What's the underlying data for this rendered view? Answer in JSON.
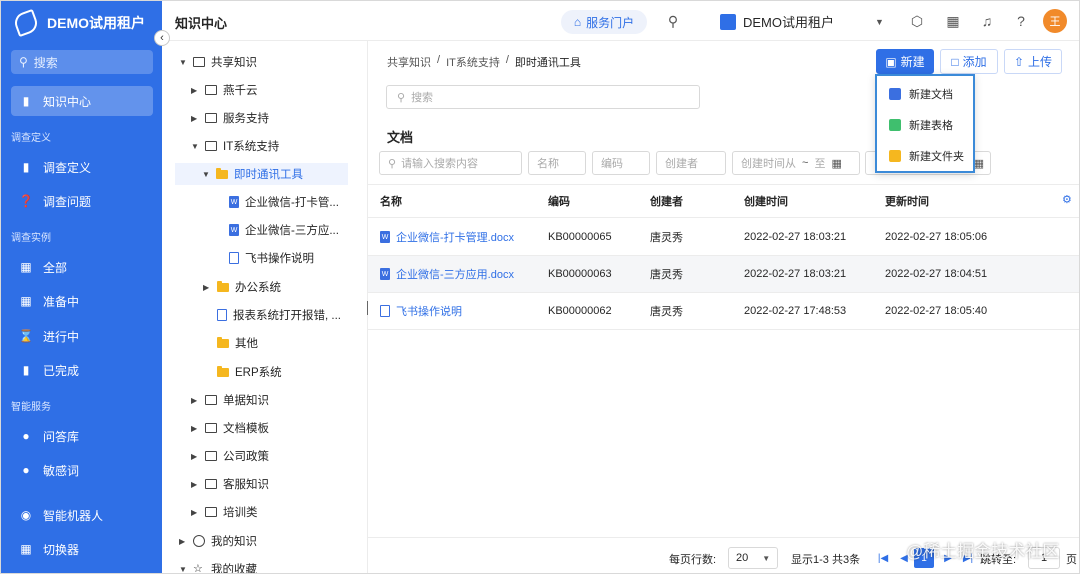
{
  "sidebar": {
    "tenant_name": "DEMO试用租户",
    "search_placeholder": "搜索",
    "items": {
      "knowledge": "知识中心",
      "survey_def": "调查定义",
      "survey_question": "调查问题",
      "all": "全部",
      "preparing": "准备中",
      "in_progress": "进行中",
      "done": "已完成",
      "qa_lib": "问答库",
      "sensitive": "敏感词",
      "bot": "智能机器人",
      "switcher": "切换器"
    },
    "groups": {
      "survey_def": "调查定义",
      "survey_instance": "调查实例",
      "smart_service": "智能服务"
    }
  },
  "topbar": {
    "title": "知识中心",
    "portal": "服务门户",
    "tenant": "DEMO试用租户",
    "avatar": "王"
  },
  "tree": {
    "root": "共享知识",
    "n1": "燕千云",
    "n2": "服务支持",
    "n3": "IT系统支持",
    "n3_1": "即时通讯工具",
    "n3_1_1": "企业微信-打卡管...",
    "n3_1_2": "企业微信-三方应...",
    "n3_1_3": "飞书操作说明",
    "n3_2": "办公系统",
    "n3_3": "报表系统打开报错, ...",
    "n3_4": "其他",
    "n3_5": "ERP系统",
    "n4": "单据知识",
    "n5": "文档模板",
    "n6": "公司政策",
    "n7": "客服知识",
    "n8": "培训类",
    "my_knowledge": "我的知识",
    "my_favorites": "我的收藏"
  },
  "main": {
    "breadcrumb": [
      "共享知识",
      "IT系统支持",
      "即时通讯工具"
    ],
    "breadcrumb_sep": "/",
    "buttons": {
      "new": "新建",
      "add": "添加",
      "upload": "上传"
    },
    "search_placeholder": "搜索",
    "section_title": "文档",
    "filters": {
      "keyword": "请输入搜索内容",
      "name": "名称",
      "code": "编码",
      "creator": "创建者",
      "created_from": "创建时间从",
      "to": "至"
    },
    "columns": [
      "名称",
      "编码",
      "创建者",
      "创建时间",
      "更新时间"
    ],
    "rows": [
      {
        "name": "企业微信-打卡管理.docx",
        "code": "KB00000065",
        "creator": "唐灵秀",
        "created": "2022-02-27 18:03:21",
        "updated": "2022-02-27 18:05:06"
      },
      {
        "name": "企业微信-三方应用.docx",
        "code": "KB00000063",
        "creator": "唐灵秀",
        "created": "2022-02-27 18:03:21",
        "updated": "2022-02-27 18:04:51"
      },
      {
        "name": "飞书操作说明",
        "code": "KB00000062",
        "creator": "唐灵秀",
        "created": "2022-02-27 17:48:53",
        "updated": "2022-02-27 18:05:40"
      }
    ],
    "footer": {
      "rows_per_page_label": "每页行数:",
      "rows_per_page": "20",
      "range": "显示1-3 共3条",
      "current_page": "1",
      "jump_label": "跳转至:",
      "jump_value": "1",
      "page_suffix": "页"
    }
  },
  "dropdown": {
    "new_doc": "新建文档",
    "new_sheet": "新建表格",
    "new_folder": "新建文件夹"
  },
  "watermark": "@稀土掘金技术社区",
  "colors": {
    "primary": "#2f6fe6",
    "folder": "#f5b71f",
    "avatar": "#f18a2a"
  }
}
